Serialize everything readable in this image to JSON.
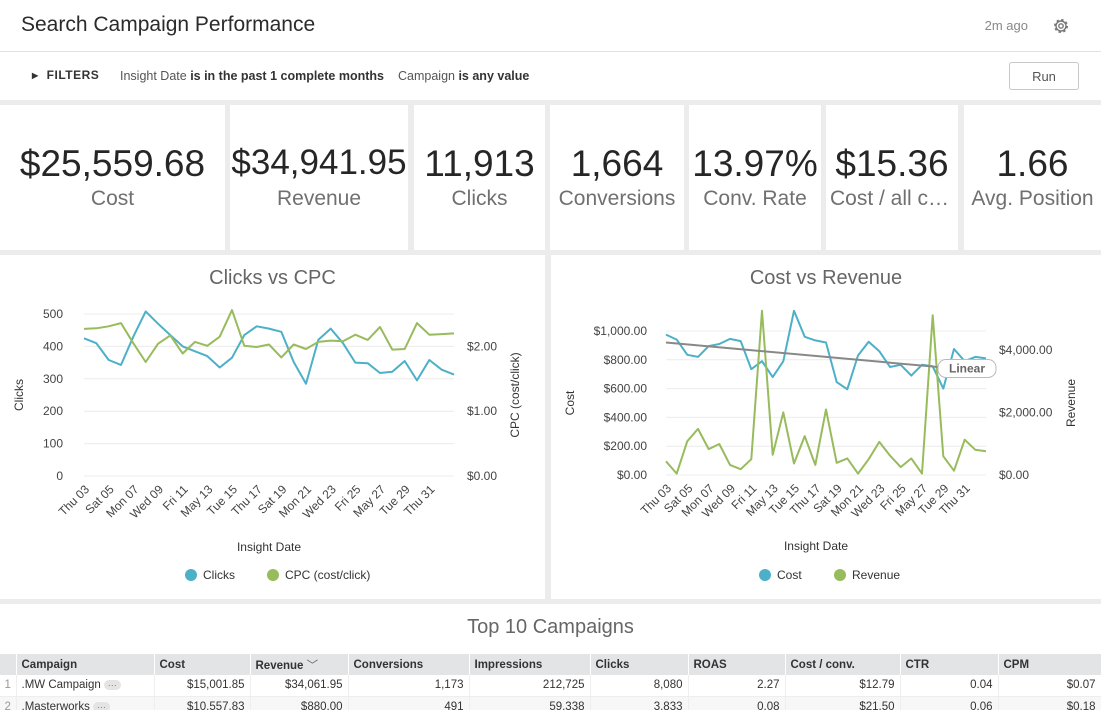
{
  "header": {
    "title": "Search Campaign Performance",
    "updated": "2m ago"
  },
  "filters": {
    "toggle_label": "FILTERS",
    "items": [
      {
        "field": "Insight Date",
        "condition": "is in the past 1 complete months"
      },
      {
        "field": "Campaign",
        "condition": "is any value"
      }
    ],
    "run_label": "Run"
  },
  "tiles": [
    {
      "value": "$25,559.68",
      "label": "Cost"
    },
    {
      "value": "$34,941.95",
      "label": "Revenue"
    },
    {
      "value": "11,913",
      "label": "Clicks"
    },
    {
      "value": "1,664",
      "label": "Conversions"
    },
    {
      "value": "13.97%",
      "label": "Conv. Rate"
    },
    {
      "value": "$15.36",
      "label": "Cost / all conv."
    },
    {
      "value": "1.66",
      "label": "Avg. Position"
    }
  ],
  "chart_data": [
    {
      "type": "line",
      "title": "Clicks vs CPC",
      "xlabel": "Insight Date",
      "ylabel": "Clicks",
      "ylabel_right": "CPC (cost/click)",
      "ylim": [
        0,
        500
      ],
      "ylim_right": [
        0,
        2.5
      ],
      "yticks": [
        "500",
        "400",
        "300",
        "200",
        "100",
        "0"
      ],
      "yticks_right": [
        "$2.00",
        "$1.00",
        "$0.00"
      ],
      "tick_labels": [
        "Thu 03",
        "Sat 05",
        "Mon 07",
        "Wed 09",
        "Fri 11",
        "May 13",
        "Tue 15",
        "Thu 17",
        "Sat 19",
        "Mon 21",
        "Wed 23",
        "Fri 25",
        "May 27",
        "Tue 29",
        "Thu 31"
      ],
      "series": [
        {
          "name": "Clicks",
          "color": "#4cb0c8",
          "axis": "left",
          "values": [
            425,
            410,
            358,
            343,
            430,
            508,
            470,
            435,
            400,
            385,
            370,
            335,
            365,
            435,
            462,
            455,
            445,
            352,
            285,
            420,
            455,
            410,
            350,
            348,
            318,
            322,
            355,
            295,
            358,
            328,
            313
          ]
        },
        {
          "name": "CPC (cost/click)",
          "color": "#98bb5c",
          "axis": "right",
          "values": [
            2.27,
            2.28,
            2.31,
            2.36,
            2.05,
            1.76,
            2.04,
            2.17,
            1.89,
            2.07,
            2.01,
            2.15,
            2.56,
            2.01,
            1.99,
            2.03,
            1.83,
            2.03,
            1.96,
            2.07,
            2.09,
            2.08,
            2.18,
            2.1,
            2.3,
            1.95,
            1.96,
            2.36,
            2.18,
            2.19,
            2.2
          ]
        }
      ]
    },
    {
      "type": "line",
      "title": "Cost vs Revenue",
      "xlabel": "Insight Date",
      "ylabel": "Cost",
      "ylabel_right": "Revenue",
      "ylim": [
        0,
        1000
      ],
      "ylim_right": [
        0,
        4600
      ],
      "yticks": [
        "$1,000.00",
        "$800.00",
        "$600.00",
        "$400.00",
        "$200.00",
        "$0.00"
      ],
      "yticks_right": [
        "$4,000.00",
        "$2,000.00",
        "$0.00"
      ],
      "tick_labels": [
        "Thu 03",
        "Sat 05",
        "Mon 07",
        "Wed 09",
        "Fri 11",
        "May 13",
        "Tue 15",
        "Thu 17",
        "Sat 19",
        "Mon 21",
        "Wed 23",
        "Fri 25",
        "May 27",
        "Tue 29",
        "Thu 31"
      ],
      "trend_label": "Linear",
      "trend": [
        920,
        740
      ],
      "series": [
        {
          "name": "Cost",
          "color": "#4cb0c8",
          "axis": "left",
          "values": [
            975,
            940,
            835,
            820,
            895,
            910,
            945,
            930,
            735,
            790,
            680,
            790,
            1140,
            960,
            935,
            920,
            645,
            595,
            830,
            925,
            860,
            750,
            765,
            690,
            765,
            755,
            600,
            875,
            790,
            820,
            810
          ]
        },
        {
          "name": "Revenue",
          "color": "#98bb5c",
          "axis": "left",
          "values": [
            95,
            10,
            235,
            320,
            180,
            215,
            70,
            40,
            110,
            1140,
            140,
            435,
            80,
            270,
            70,
            455,
            85,
            115,
            10,
            110,
            230,
            135,
            55,
            115,
            10,
            1110,
            130,
            30,
            245,
            175,
            165
          ]
        }
      ]
    }
  ],
  "table": {
    "title": "Top 10 Campaigns",
    "columns": [
      "Campaign",
      "Cost",
      "Revenue",
      "Conversions",
      "Impressions",
      "Clicks",
      "ROAS",
      "Cost / conv.",
      "CTR",
      "CPM"
    ],
    "sort_indicator": "﹀",
    "more_label": "···",
    "rows": [
      {
        "n": "1",
        "cells": [
          ".MW Campaign",
          "$15,001.85",
          "$34,061.95",
          "1,173",
          "212,725",
          "8,080",
          "2.27",
          "$12.79",
          "0.04",
          "$0.07"
        ]
      },
      {
        "n": "2",
        "cells": [
          ".Masterworks",
          "$10,557.83",
          "$880.00",
          "491",
          "59,338",
          "3,833",
          "0.08",
          "$21.50",
          "0.06",
          "$0.18"
        ]
      }
    ]
  }
}
